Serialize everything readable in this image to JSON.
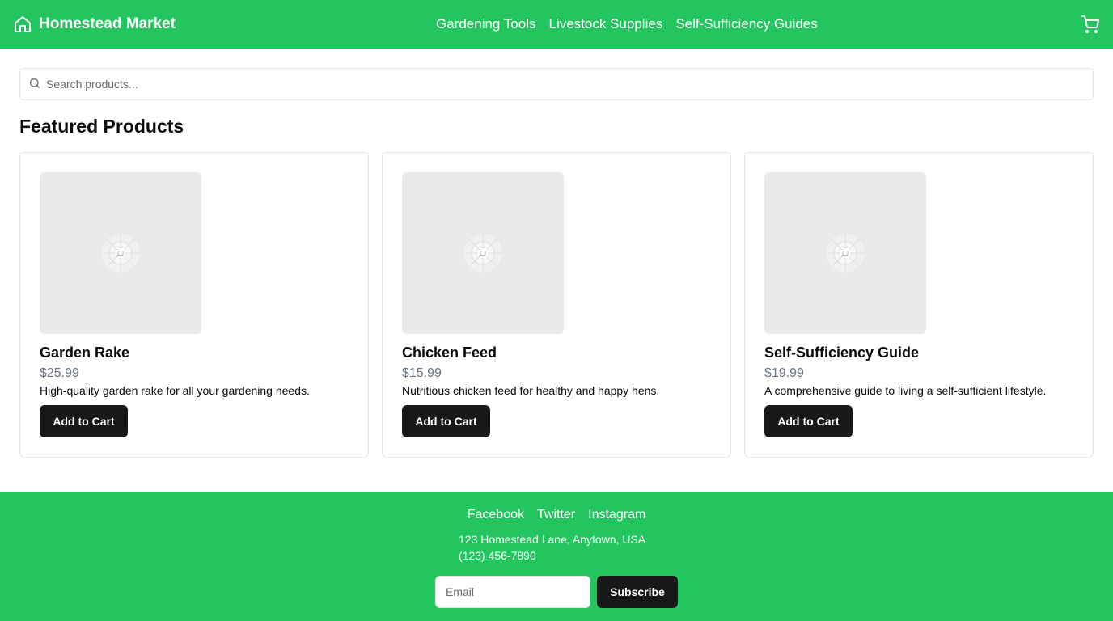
{
  "header": {
    "brand": "Homestead Market",
    "brand_icon": "home-icon",
    "nav": [
      "Gardening Tools",
      "Livestock Supplies",
      "Self-Sufficiency Guides"
    ],
    "cart_icon": "shopping-cart-icon"
  },
  "search": {
    "placeholder": "Search products...",
    "value": "",
    "icon": "search-icon"
  },
  "main": {
    "section_title": "Featured Products",
    "products": [
      {
        "name": "Garden Rake",
        "price": "$25.99",
        "description": "High-quality garden rake for all your gardening needs.",
        "button": "Add to Cart",
        "image_icon": "image-placeholder-icon"
      },
      {
        "name": "Chicken Feed",
        "price": "$15.99",
        "description": "Nutritious chicken feed for healthy and happy hens.",
        "button": "Add to Cart",
        "image_icon": "image-placeholder-icon"
      },
      {
        "name": "Self-Sufficiency Guide",
        "price": "$19.99",
        "description": "A comprehensive guide to living a self-sufficient lifestyle.",
        "button": "Add to Cart",
        "image_icon": "image-placeholder-icon"
      }
    ]
  },
  "footer": {
    "social": [
      "Facebook",
      "Twitter",
      "Instagram"
    ],
    "address": "123 Homestead Lane, Anytown, USA",
    "phone": "(123) 456-7890",
    "email_placeholder": "Email",
    "email_value": "",
    "subscribe": "Subscribe"
  },
  "colors": {
    "brand_green": "#22c55e",
    "button_dark": "#18181b",
    "price_gray": "#6b7280",
    "border": "#e5e5e5",
    "image_placeholder": "#e9e9e9"
  }
}
